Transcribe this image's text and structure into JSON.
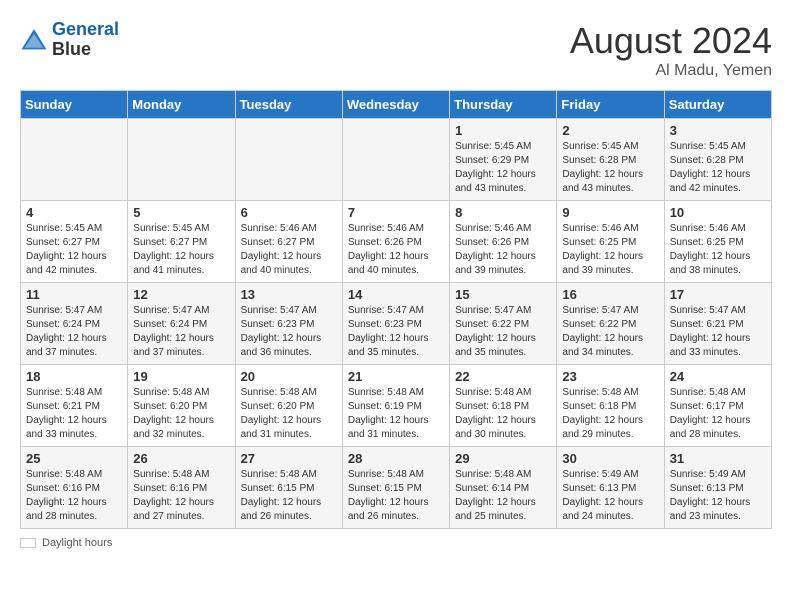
{
  "header": {
    "logo_line1": "General",
    "logo_line2": "Blue",
    "month": "August 2024",
    "location": "Al Madu, Yemen"
  },
  "weekdays": [
    "Sunday",
    "Monday",
    "Tuesday",
    "Wednesday",
    "Thursday",
    "Friday",
    "Saturday"
  ],
  "weeks": [
    [
      {
        "day": "",
        "info": ""
      },
      {
        "day": "",
        "info": ""
      },
      {
        "day": "",
        "info": ""
      },
      {
        "day": "",
        "info": ""
      },
      {
        "day": "1",
        "info": "Sunrise: 5:45 AM\nSunset: 6:29 PM\nDaylight: 12 hours and 43 minutes."
      },
      {
        "day": "2",
        "info": "Sunrise: 5:45 AM\nSunset: 6:28 PM\nDaylight: 12 hours and 43 minutes."
      },
      {
        "day": "3",
        "info": "Sunrise: 5:45 AM\nSunset: 6:28 PM\nDaylight: 12 hours and 42 minutes."
      }
    ],
    [
      {
        "day": "4",
        "info": "Sunrise: 5:45 AM\nSunset: 6:27 PM\nDaylight: 12 hours and 42 minutes."
      },
      {
        "day": "5",
        "info": "Sunrise: 5:45 AM\nSunset: 6:27 PM\nDaylight: 12 hours and 41 minutes."
      },
      {
        "day": "6",
        "info": "Sunrise: 5:46 AM\nSunset: 6:27 PM\nDaylight: 12 hours and 40 minutes."
      },
      {
        "day": "7",
        "info": "Sunrise: 5:46 AM\nSunset: 6:26 PM\nDaylight: 12 hours and 40 minutes."
      },
      {
        "day": "8",
        "info": "Sunrise: 5:46 AM\nSunset: 6:26 PM\nDaylight: 12 hours and 39 minutes."
      },
      {
        "day": "9",
        "info": "Sunrise: 5:46 AM\nSunset: 6:25 PM\nDaylight: 12 hours and 39 minutes."
      },
      {
        "day": "10",
        "info": "Sunrise: 5:46 AM\nSunset: 6:25 PM\nDaylight: 12 hours and 38 minutes."
      }
    ],
    [
      {
        "day": "11",
        "info": "Sunrise: 5:47 AM\nSunset: 6:24 PM\nDaylight: 12 hours and 37 minutes."
      },
      {
        "day": "12",
        "info": "Sunrise: 5:47 AM\nSunset: 6:24 PM\nDaylight: 12 hours and 37 minutes."
      },
      {
        "day": "13",
        "info": "Sunrise: 5:47 AM\nSunset: 6:23 PM\nDaylight: 12 hours and 36 minutes."
      },
      {
        "day": "14",
        "info": "Sunrise: 5:47 AM\nSunset: 6:23 PM\nDaylight: 12 hours and 35 minutes."
      },
      {
        "day": "15",
        "info": "Sunrise: 5:47 AM\nSunset: 6:22 PM\nDaylight: 12 hours and 35 minutes."
      },
      {
        "day": "16",
        "info": "Sunrise: 5:47 AM\nSunset: 6:22 PM\nDaylight: 12 hours and 34 minutes."
      },
      {
        "day": "17",
        "info": "Sunrise: 5:47 AM\nSunset: 6:21 PM\nDaylight: 12 hours and 33 minutes."
      }
    ],
    [
      {
        "day": "18",
        "info": "Sunrise: 5:48 AM\nSunset: 6:21 PM\nDaylight: 12 hours and 33 minutes."
      },
      {
        "day": "19",
        "info": "Sunrise: 5:48 AM\nSunset: 6:20 PM\nDaylight: 12 hours and 32 minutes."
      },
      {
        "day": "20",
        "info": "Sunrise: 5:48 AM\nSunset: 6:20 PM\nDaylight: 12 hours and 31 minutes."
      },
      {
        "day": "21",
        "info": "Sunrise: 5:48 AM\nSunset: 6:19 PM\nDaylight: 12 hours and 31 minutes."
      },
      {
        "day": "22",
        "info": "Sunrise: 5:48 AM\nSunset: 6:18 PM\nDaylight: 12 hours and 30 minutes."
      },
      {
        "day": "23",
        "info": "Sunrise: 5:48 AM\nSunset: 6:18 PM\nDaylight: 12 hours and 29 minutes."
      },
      {
        "day": "24",
        "info": "Sunrise: 5:48 AM\nSunset: 6:17 PM\nDaylight: 12 hours and 28 minutes."
      }
    ],
    [
      {
        "day": "25",
        "info": "Sunrise: 5:48 AM\nSunset: 6:16 PM\nDaylight: 12 hours and 28 minutes."
      },
      {
        "day": "26",
        "info": "Sunrise: 5:48 AM\nSunset: 6:16 PM\nDaylight: 12 hours and 27 minutes."
      },
      {
        "day": "27",
        "info": "Sunrise: 5:48 AM\nSunset: 6:15 PM\nDaylight: 12 hours and 26 minutes."
      },
      {
        "day": "28",
        "info": "Sunrise: 5:48 AM\nSunset: 6:15 PM\nDaylight: 12 hours and 26 minutes."
      },
      {
        "day": "29",
        "info": "Sunrise: 5:48 AM\nSunset: 6:14 PM\nDaylight: 12 hours and 25 minutes."
      },
      {
        "day": "30",
        "info": "Sunrise: 5:49 AM\nSunset: 6:13 PM\nDaylight: 12 hours and 24 minutes."
      },
      {
        "day": "31",
        "info": "Sunrise: 5:49 AM\nSunset: 6:13 PM\nDaylight: 12 hours and 23 minutes."
      }
    ]
  ],
  "footer": {
    "label": "Daylight hours"
  }
}
